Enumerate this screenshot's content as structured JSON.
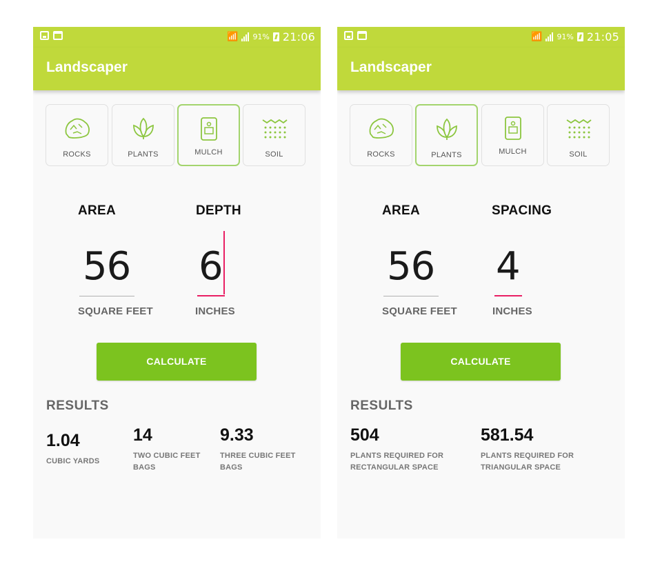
{
  "left": {
    "status": {
      "battery": "91%",
      "time": "21:06"
    },
    "app_title": "Landscaper",
    "tiles": [
      {
        "label": "ROCKS",
        "icon": "rock-icon"
      },
      {
        "label": "PLANTS",
        "icon": "plant-icon"
      },
      {
        "label": "MULCH",
        "icon": "mulch-bag-icon"
      },
      {
        "label": "SOIL",
        "icon": "soil-icon"
      }
    ],
    "selected_tile": "MULCH",
    "field1": {
      "label": "AREA",
      "value": "56",
      "unit": "SQUARE FEET"
    },
    "field2": {
      "label": "DEPTH",
      "value": "6",
      "unit": "INCHES"
    },
    "button": "CALCULATE",
    "results_heading": "RESULTS",
    "results": [
      {
        "value": "1.04",
        "label": "CUBIC YARDS"
      },
      {
        "value": "14",
        "label": "TWO CUBIC FEET BAGS"
      },
      {
        "value": "9.33",
        "label": "THREE CUBIC FEET BAGS"
      }
    ]
  },
  "right": {
    "status": {
      "battery": "91%",
      "time": "21:05"
    },
    "app_title": "Landscaper",
    "tiles": [
      {
        "label": "ROCKS",
        "icon": "rock-icon"
      },
      {
        "label": "PLANTS",
        "icon": "plant-icon"
      },
      {
        "label": "MULCH",
        "icon": "mulch-bag-icon"
      },
      {
        "label": "SOIL",
        "icon": "soil-icon"
      }
    ],
    "selected_tile": "PLANTS",
    "field1": {
      "label": "AREA",
      "value": "56",
      "unit": "SQUARE FEET"
    },
    "field2": {
      "label": "SPACING",
      "value": "4",
      "unit": "INCHES"
    },
    "button": "CALCULATE",
    "results_heading": "RESULTS",
    "results": [
      {
        "value": "504",
        "label": "PLANTS REQUIRED FOR RECTANGULAR SPACE"
      },
      {
        "value": "581.54",
        "label": "PLANTS REQUIRED FOR TRIANGULAR SPACE"
      }
    ]
  },
  "colors": {
    "accent": "#c0d93b",
    "button": "#7cc31f",
    "icon": "#8cc63f",
    "focus": "#e91e63"
  }
}
